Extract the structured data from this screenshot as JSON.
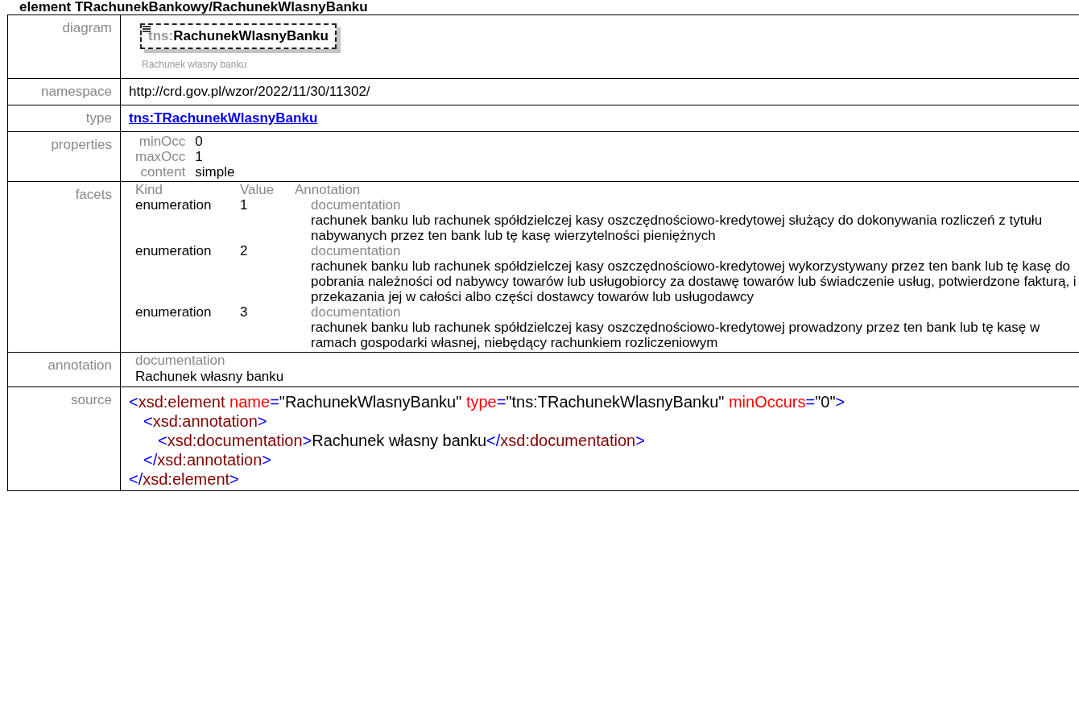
{
  "page_title": "element TRachunekBankowy/RachunekWlasnyBanku",
  "rows": [
    {
      "kind": "diagram",
      "label": "diagram",
      "prefix": "tns:",
      "name": "RachunekWlasnyBanku",
      "caption": "Rachunek własny banku"
    },
    {
      "kind": "text",
      "label": "namespace",
      "value": "http://crd.gov.pl/wzor/2022/11/30/11302/"
    },
    {
      "kind": "link",
      "label": "type",
      "value": "tns:TRachunekWlasnyBanku"
    },
    {
      "kind": "properties",
      "label": "properties",
      "items": [
        {
          "name": "minOcc",
          "value": "0"
        },
        {
          "name": "maxOcc",
          "value": "1"
        },
        {
          "name": "content",
          "value": "simple"
        }
      ]
    },
    {
      "kind": "facets",
      "label": "facets",
      "columns": [
        "Kind",
        "Value",
        "Annotation"
      ],
      "items": [
        {
          "kind": "enumeration",
          "value": "1",
          "doc_label": "documentation",
          "doc": "rachunek banku lub rachunek spółdzielczej kasy oszczędnościowo-kredytowej służący do dokonywania rozliczeń z tytułu nabywanych przez ten bank lub tę kasę wierzytelności pieniężnych"
        },
        {
          "kind": "enumeration",
          "value": "2",
          "doc_label": "documentation",
          "doc": "rachunek banku lub rachunek spółdzielczej kasy oszczędnościowo-kredytowej wykorzystywany przez ten bank lub tę kasę do pobrania należności od nabywcy towarów lub usługobiorcy za dostawę towarów lub świadczenie usług, potwierdzone fakturą, i przekazania jej w całości albo części dostawcy towarów lub usługodawcy"
        },
        {
          "kind": "enumeration",
          "value": "3",
          "doc_label": "documentation",
          "doc": "rachunek banku lub rachunek spółdzielczej kasy oszczędnościowo-kredytowej prowadzony przez ten bank lub tę kasę w ramach gospodarki własnej, niebędący rachunkiem rozliczeniowym"
        }
      ]
    },
    {
      "kind": "annotation",
      "label": "annotation",
      "doc_label": "documentation",
      "doc": "Rachunek własny banku"
    },
    {
      "kind": "source",
      "label": "source",
      "lines": [
        {
          "open": [
            {
              "kind": "punct",
              "text": "<"
            },
            {
              "kind": "tag",
              "text": "xsd:element"
            },
            {
              "kind": "attr",
              "text": " name"
            },
            {
              "kind": "punct",
              "text": "="
            },
            {
              "kind": "value",
              "text": "\"RachunekWlasnyBanku\""
            },
            {
              "kind": "attr",
              "text": " type"
            },
            {
              "kind": "punct",
              "text": "="
            },
            {
              "kind": "value",
              "text": "\"tns:TRachunekWlasnyBanku\""
            },
            {
              "kind": "attr",
              "text": " minOccurs"
            },
            {
              "kind": "punct",
              "text": "="
            },
            {
              "kind": "value",
              "text": "\"0\""
            },
            {
              "kind": "punct",
              "text": ">"
            }
          ],
          "children": [
            {
              "open": [
                {
                  "kind": "punct",
                  "text": "<"
                },
                {
                  "kind": "tag",
                  "text": "xsd:annotation"
                },
                {
                  "kind": "punct",
                  "text": ">"
                }
              ],
              "children": [
                {
                  "open": [
                    {
                      "kind": "punct",
                      "text": "<"
                    },
                    {
                      "kind": "tag",
                      "text": "xsd:documentation"
                    },
                    {
                      "kind": "punct",
                      "text": ">"
                    },
                    {
                      "kind": "value",
                      "text": "Rachunek własny banku"
                    },
                    {
                      "kind": "punct",
                      "text": "</"
                    },
                    {
                      "kind": "tag",
                      "text": "xsd:documentation"
                    },
                    {
                      "kind": "punct",
                      "text": ">"
                    }
                  ]
                }
              ],
              "close": [
                {
                  "kind": "punct",
                  "text": "</"
                },
                {
                  "kind": "tag",
                  "text": "xsd:annotation"
                },
                {
                  "kind": "punct",
                  "text": ">"
                }
              ]
            }
          ],
          "close": [
            {
              "kind": "punct",
              "text": "</"
            },
            {
              "kind": "tag",
              "text": "xsd:element"
            },
            {
              "kind": "punct",
              "text": ">"
            }
          ]
        }
      ]
    }
  ]
}
